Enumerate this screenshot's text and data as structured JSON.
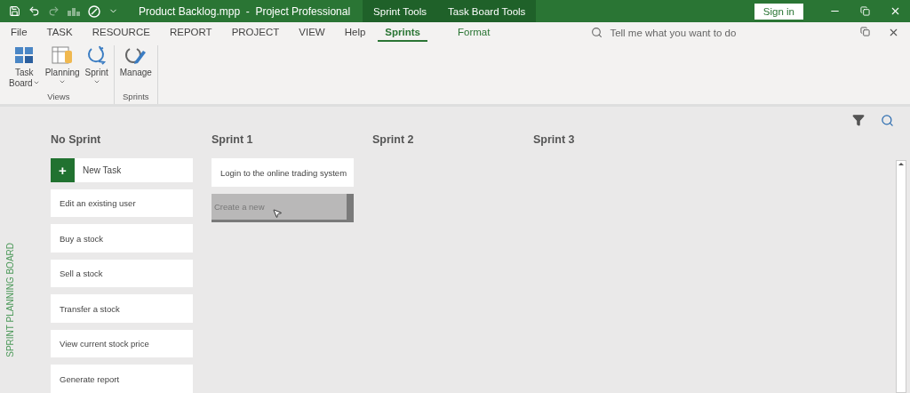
{
  "title_bar": {
    "title": "Product Backlog.mpp  -  Project Professional",
    "context_tabs": [
      "Sprint Tools",
      "Task Board Tools"
    ],
    "sign_in": "Sign in"
  },
  "menu_tabs": [
    {
      "label": "File",
      "selected": false,
      "contextual": false
    },
    {
      "label": "TASK",
      "selected": false,
      "contextual": false
    },
    {
      "label": "RESOURCE",
      "selected": false,
      "contextual": false
    },
    {
      "label": "REPORT",
      "selected": false,
      "contextual": false
    },
    {
      "label": "PROJECT",
      "selected": false,
      "contextual": false
    },
    {
      "label": "VIEW",
      "selected": false,
      "contextual": false
    },
    {
      "label": "Help",
      "selected": false,
      "contextual": false
    },
    {
      "label": "Sprints",
      "selected": true,
      "contextual": true
    },
    {
      "label": "Format",
      "selected": false,
      "contextual": true
    }
  ],
  "tell_me": {
    "placeholder": "Tell me what you want to do"
  },
  "ribbon_groups": [
    {
      "label": "Views",
      "buttons": [
        {
          "kind": "taskboard",
          "label": [
            "Task",
            "Board"
          ],
          "dropdown": true
        },
        {
          "kind": "planning",
          "label": [
            "Planning"
          ],
          "dropdown": true
        },
        {
          "kind": "sprint",
          "label": [
            "Sprint"
          ],
          "dropdown": true
        }
      ]
    },
    {
      "label": "Sprints",
      "buttons": [
        {
          "kind": "manage",
          "label": [
            "Manage"
          ],
          "dropdown": false
        }
      ]
    }
  ],
  "board": {
    "side_label": "SPRINT PLANNING BOARD",
    "columns": [
      {
        "title": "No Sprint",
        "cards": [
          {
            "kind": "new",
            "text": "New Task",
            "symbol": "+"
          },
          {
            "kind": "task",
            "text": "Edit an existing user"
          },
          {
            "kind": "task",
            "text": "Buy a stock"
          },
          {
            "kind": "task",
            "text": "Sell a stock"
          },
          {
            "kind": "task",
            "text": "Transfer a stock"
          },
          {
            "kind": "task",
            "text": "View current stock price"
          },
          {
            "kind": "task",
            "text": "Generate report"
          }
        ]
      },
      {
        "title": "Sprint 1",
        "cards": [
          {
            "kind": "task",
            "text": "Login to the online trading system"
          },
          {
            "kind": "dragging",
            "text": "Create a new"
          }
        ]
      },
      {
        "title": "Sprint 2"
      },
      {
        "title": "Sprint 3"
      }
    ]
  }
}
